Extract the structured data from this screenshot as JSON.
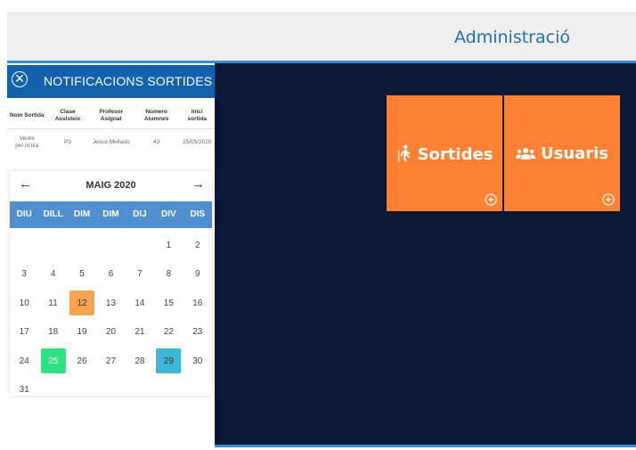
{
  "header": {
    "title": "Administració"
  },
  "notifications": {
    "title": "NOTIFICACIONS SORTIDES",
    "columns": [
      "Nom Sortida",
      "Clase Assisteix",
      "Profesor Asignat",
      "Número Alumnes",
      "Inici sortida"
    ],
    "rows": [
      [
        "Veure pel·lícula",
        "P3",
        "Jesus Mellado",
        "43",
        "25/05/2020"
      ]
    ]
  },
  "calendar": {
    "month": "MAIG 2020",
    "prev_icon": "arrow-left-icon",
    "next_icon": "arrow-right-icon",
    "weekdays": [
      "DIU",
      "DILL",
      "DIM",
      "DIM",
      "DIJ",
      "DIV",
      "DIS"
    ],
    "days": [
      "",
      "",
      "",
      "",
      "",
      "1",
      "2",
      "3",
      "4",
      "5",
      "6",
      "7",
      "8",
      "9",
      "10",
      "11",
      "12",
      "13",
      "14",
      "15",
      "16",
      "17",
      "18",
      "19",
      "20",
      "21",
      "22",
      "23",
      "24",
      "25",
      "26",
      "27",
      "28",
      "29",
      "30",
      "31",
      "",
      "",
      "",
      "",
      "",
      ""
    ],
    "highlights": {
      "12": "orange",
      "25": "green",
      "29": "blue"
    },
    "highlight_colors": {
      "orange": "#f7a34f",
      "green": "#2fe384",
      "blue": "#3db6d7"
    }
  },
  "tiles": {
    "sortides": {
      "label": "Sortides",
      "icon": "hiking-icon",
      "action_icon": "plus-circle-icon"
    },
    "usuaris": {
      "label": "Usuaris",
      "icon": "users-icon",
      "action_icon": "plus-circle-icon"
    }
  },
  "colors": {
    "header_bg": "#f0f0f0",
    "accent_blue": "#1262ad",
    "main_bg": "#0b1835",
    "tile_orange": "#fe8133"
  }
}
